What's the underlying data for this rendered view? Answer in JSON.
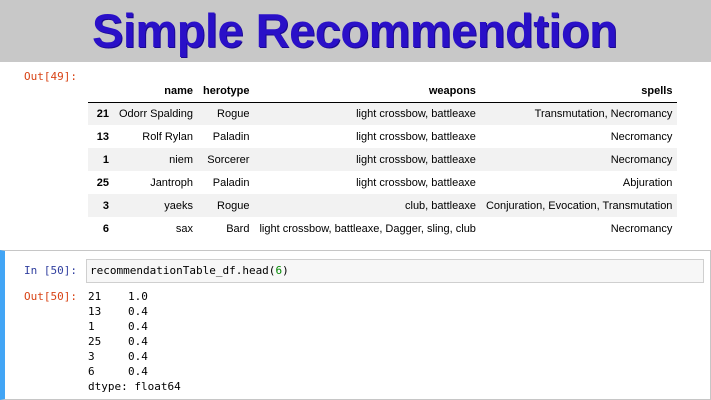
{
  "banner": {
    "title": "Simple Recommendtion"
  },
  "cell_out_49": {
    "prompt": "Out[49]:",
    "columns": [
      "",
      "name",
      "herotype",
      "weapons",
      "spells"
    ],
    "rows": [
      {
        "index": "21",
        "name": "Odorr Spalding",
        "herotype": "Rogue",
        "weapons": "light crossbow, battleaxe",
        "spells": "Transmutation, Necromancy"
      },
      {
        "index": "13",
        "name": "Rolf Rylan",
        "herotype": "Paladin",
        "weapons": "light crossbow, battleaxe",
        "spells": "Necromancy"
      },
      {
        "index": "1",
        "name": "niem",
        "herotype": "Sorcerer",
        "weapons": "light crossbow, battleaxe",
        "spells": "Necromancy"
      },
      {
        "index": "25",
        "name": "Jantroph",
        "herotype": "Paladin",
        "weapons": "light crossbow, battleaxe",
        "spells": "Abjuration"
      },
      {
        "index": "3",
        "name": "yaeks",
        "herotype": "Rogue",
        "weapons": "club, battleaxe",
        "spells": "Conjuration, Evocation, Transmutation"
      },
      {
        "index": "6",
        "name": "sax",
        "herotype": "Bard",
        "weapons": "light crossbow, battleaxe, Dagger, sling, club",
        "spells": "Necromancy"
      }
    ]
  },
  "cell_in_50": {
    "prompt": "In [50]:",
    "code_prefix": "recommendationTable_df.head(",
    "code_arg": "6",
    "code_suffix": ")"
  },
  "cell_out_50": {
    "prompt": "Out[50]:",
    "series": [
      {
        "index": "21",
        "value": "1.0"
      },
      {
        "index": "13",
        "value": "0.4"
      },
      {
        "index": "1",
        "value": "0.4"
      },
      {
        "index": "25",
        "value": "0.4"
      },
      {
        "index": "3",
        "value": "0.4"
      },
      {
        "index": "6",
        "value": "0.4"
      }
    ],
    "dtype": "dtype: float64"
  }
}
